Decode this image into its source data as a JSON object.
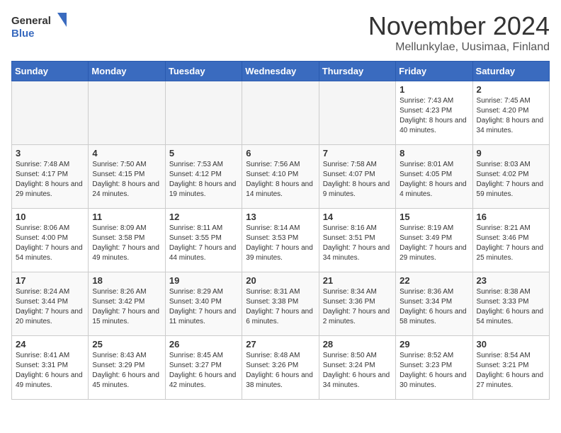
{
  "header": {
    "logo_general": "General",
    "logo_blue": "Blue",
    "month": "November 2024",
    "location": "Mellunkylae, Uusimaa, Finland"
  },
  "weekdays": [
    "Sunday",
    "Monday",
    "Tuesday",
    "Wednesday",
    "Thursday",
    "Friday",
    "Saturday"
  ],
  "weeks": [
    [
      {
        "day": "",
        "info": ""
      },
      {
        "day": "",
        "info": ""
      },
      {
        "day": "",
        "info": ""
      },
      {
        "day": "",
        "info": ""
      },
      {
        "day": "",
        "info": ""
      },
      {
        "day": "1",
        "info": "Sunrise: 7:43 AM\nSunset: 4:23 PM\nDaylight: 8 hours and 40 minutes."
      },
      {
        "day": "2",
        "info": "Sunrise: 7:45 AM\nSunset: 4:20 PM\nDaylight: 8 hours and 34 minutes."
      }
    ],
    [
      {
        "day": "3",
        "info": "Sunrise: 7:48 AM\nSunset: 4:17 PM\nDaylight: 8 hours and 29 minutes."
      },
      {
        "day": "4",
        "info": "Sunrise: 7:50 AM\nSunset: 4:15 PM\nDaylight: 8 hours and 24 minutes."
      },
      {
        "day": "5",
        "info": "Sunrise: 7:53 AM\nSunset: 4:12 PM\nDaylight: 8 hours and 19 minutes."
      },
      {
        "day": "6",
        "info": "Sunrise: 7:56 AM\nSunset: 4:10 PM\nDaylight: 8 hours and 14 minutes."
      },
      {
        "day": "7",
        "info": "Sunrise: 7:58 AM\nSunset: 4:07 PM\nDaylight: 8 hours and 9 minutes."
      },
      {
        "day": "8",
        "info": "Sunrise: 8:01 AM\nSunset: 4:05 PM\nDaylight: 8 hours and 4 minutes."
      },
      {
        "day": "9",
        "info": "Sunrise: 8:03 AM\nSunset: 4:02 PM\nDaylight: 7 hours and 59 minutes."
      }
    ],
    [
      {
        "day": "10",
        "info": "Sunrise: 8:06 AM\nSunset: 4:00 PM\nDaylight: 7 hours and 54 minutes."
      },
      {
        "day": "11",
        "info": "Sunrise: 8:09 AM\nSunset: 3:58 PM\nDaylight: 7 hours and 49 minutes."
      },
      {
        "day": "12",
        "info": "Sunrise: 8:11 AM\nSunset: 3:55 PM\nDaylight: 7 hours and 44 minutes."
      },
      {
        "day": "13",
        "info": "Sunrise: 8:14 AM\nSunset: 3:53 PM\nDaylight: 7 hours and 39 minutes."
      },
      {
        "day": "14",
        "info": "Sunrise: 8:16 AM\nSunset: 3:51 PM\nDaylight: 7 hours and 34 minutes."
      },
      {
        "day": "15",
        "info": "Sunrise: 8:19 AM\nSunset: 3:49 PM\nDaylight: 7 hours and 29 minutes."
      },
      {
        "day": "16",
        "info": "Sunrise: 8:21 AM\nSunset: 3:46 PM\nDaylight: 7 hours and 25 minutes."
      }
    ],
    [
      {
        "day": "17",
        "info": "Sunrise: 8:24 AM\nSunset: 3:44 PM\nDaylight: 7 hours and 20 minutes."
      },
      {
        "day": "18",
        "info": "Sunrise: 8:26 AM\nSunset: 3:42 PM\nDaylight: 7 hours and 15 minutes."
      },
      {
        "day": "19",
        "info": "Sunrise: 8:29 AM\nSunset: 3:40 PM\nDaylight: 7 hours and 11 minutes."
      },
      {
        "day": "20",
        "info": "Sunrise: 8:31 AM\nSunset: 3:38 PM\nDaylight: 7 hours and 6 minutes."
      },
      {
        "day": "21",
        "info": "Sunrise: 8:34 AM\nSunset: 3:36 PM\nDaylight: 7 hours and 2 minutes."
      },
      {
        "day": "22",
        "info": "Sunrise: 8:36 AM\nSunset: 3:34 PM\nDaylight: 6 hours and 58 minutes."
      },
      {
        "day": "23",
        "info": "Sunrise: 8:38 AM\nSunset: 3:33 PM\nDaylight: 6 hours and 54 minutes."
      }
    ],
    [
      {
        "day": "24",
        "info": "Sunrise: 8:41 AM\nSunset: 3:31 PM\nDaylight: 6 hours and 49 minutes."
      },
      {
        "day": "25",
        "info": "Sunrise: 8:43 AM\nSunset: 3:29 PM\nDaylight: 6 hours and 45 minutes."
      },
      {
        "day": "26",
        "info": "Sunrise: 8:45 AM\nSunset: 3:27 PM\nDaylight: 6 hours and 42 minutes."
      },
      {
        "day": "27",
        "info": "Sunrise: 8:48 AM\nSunset: 3:26 PM\nDaylight: 6 hours and 38 minutes."
      },
      {
        "day": "28",
        "info": "Sunrise: 8:50 AM\nSunset: 3:24 PM\nDaylight: 6 hours and 34 minutes."
      },
      {
        "day": "29",
        "info": "Sunrise: 8:52 AM\nSunset: 3:23 PM\nDaylight: 6 hours and 30 minutes."
      },
      {
        "day": "30",
        "info": "Sunrise: 8:54 AM\nSunset: 3:21 PM\nDaylight: 6 hours and 27 minutes."
      }
    ]
  ]
}
